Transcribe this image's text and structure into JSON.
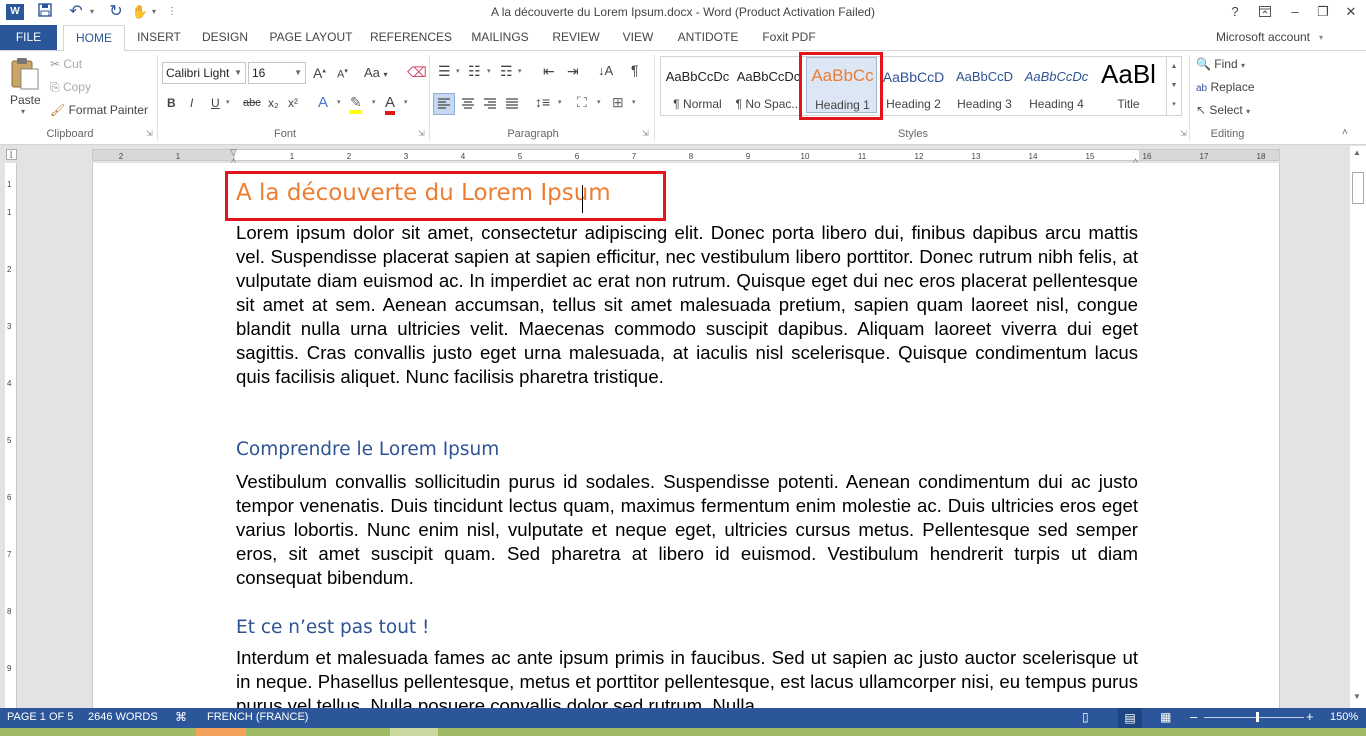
{
  "window": {
    "title": "A la découverte du Lorem Ipsum.docx - Word (Product Activation Failed)",
    "help": "?",
    "minimize": "–",
    "restore": "❐",
    "close": "✕"
  },
  "tabs": [
    "FILE",
    "HOME",
    "INSERT",
    "DESIGN",
    "PAGE LAYOUT",
    "REFERENCES",
    "MAILINGS",
    "REVIEW",
    "VIEW",
    "ANTIDOTE",
    "Foxit PDF"
  ],
  "account": "Microsoft account",
  "clipboard": {
    "paste": "Paste",
    "cut": "Cut",
    "copy": "Copy",
    "format_painter": "Format Painter",
    "label": "Clipboard"
  },
  "font": {
    "name": "Calibri Light",
    "size": "16",
    "label": "Font",
    "bold": "B",
    "italic": "I",
    "underline": "U",
    "strike": "abc",
    "sub": "x₂",
    "sup": "x²",
    "grow": "A",
    "shrink": "A",
    "case": "Aa",
    "color": "A"
  },
  "paragraph": {
    "label": "Paragraph",
    "pilcrow": "¶"
  },
  "styles": {
    "label": "Styles",
    "items": [
      {
        "sample": "AaBbCcDc",
        "name": "¶ Normal"
      },
      {
        "sample": "AaBbCcDc",
        "name": "¶ No Spac..."
      },
      {
        "sample": "AaBbCc",
        "name": "Heading 1"
      },
      {
        "sample": "AaBbCcD",
        "name": "Heading 2"
      },
      {
        "sample": "AaBbCcD",
        "name": "Heading 3"
      },
      {
        "sample": "AaBbCcDc",
        "name": "Heading 4"
      },
      {
        "sample": "AaBl",
        "name": "Title"
      }
    ]
  },
  "editing": {
    "label": "Editing",
    "find": "Find",
    "replace": "Replace",
    "select": "Select"
  },
  "ruler": {
    "numbers": [
      "2",
      "1",
      "1",
      "2",
      "3",
      "4",
      "5",
      "6",
      "7",
      "8",
      "9",
      "10",
      "11",
      "12",
      "13",
      "14",
      "15",
      "16",
      "17",
      "18"
    ],
    "vnumbers": [
      "1",
      "1",
      "2",
      "3",
      "4",
      "5",
      "6",
      "7",
      "8",
      "9"
    ]
  },
  "document": {
    "title": "A la découverte du Lorem Ipsum",
    "p1": "Lorem ipsum dolor sit amet, consectetur adipiscing elit. Donec porta libero dui, finibus dapibus arcu mattis vel. Suspendisse placerat sapien at sapien efficitur, nec vestibulum libero porttitor. Donec rutrum nibh felis, at vulputate diam euismod ac. In imperdiet ac erat non rutrum. Quisque eget dui nec eros placerat pellentesque sit amet at sem. Aenean accumsan, tellus sit amet malesuada pretium, sapien quam laoreet nisl, congue blandit nulla urna ultricies velit. Maecenas commodo suscipit dapibus. Aliquam laoreet viverra dui eget sagittis. Cras convallis justo eget urna malesuada, at iaculis nisl scelerisque. Quisque condimentum lacus quis facilisis aliquet. Nunc facilisis pharetra tristique.",
    "h2a": "Comprendre le Lorem Ipsum",
    "p2": "Vestibulum convallis sollicitudin purus id sodales. Suspendisse potenti. Aenean condimentum dui ac justo tempor venenatis. Duis tincidunt lectus quam, maximus fermentum enim molestie ac. Duis ultricies eros eget varius lobortis. Nunc enim nisl, vulputate et neque eget, ultricies cursus metus. Pellentesque sed semper eros, sit amet suscipit quam. Sed pharetra at libero id euismod. Vestibulum hendrerit turpis ut diam consequat bibendum.",
    "h2b": "Et ce n’est pas tout !",
    "p3": "Interdum et malesuada fames ac ante ipsum primis in faucibus. Sed ut sapien ac justo auctor scelerisque ut in neque. Phasellus pellentesque, metus et porttitor pellentesque, est lacus ullamcorper nisi, eu tempus purus purus vel tellus. Nulla posuere convallis dolor sed rutrum. Nulla"
  },
  "status": {
    "page": "PAGE 1 OF 5",
    "words": "2646 WORDS",
    "language": "FRENCH (FRANCE)",
    "zoom": "150%",
    "zoom_minus": "–",
    "zoom_plus": "+"
  },
  "colors": {
    "accent": "#2b579a",
    "heading1": "#ec7d31",
    "heading2": "#2e5395",
    "highlight_box": "#e3151a"
  }
}
